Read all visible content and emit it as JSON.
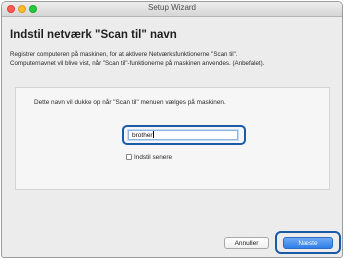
{
  "window": {
    "title": "Setup Wizard"
  },
  "page": {
    "heading": "Indstil netværk \"Scan til\" navn",
    "description_line1": "Registrer computeren på maskinen, for at aktivere Netværksfunktionerne \"Scan til\".",
    "description_line2": "Computernavnet vil blive vist, når \"Scan til\"-funktionerne på maskinen anvendes. (Anbefalet)."
  },
  "panel": {
    "info_text": "Dette navn vil dukke op når \"Scan til\" menuen vælges på maskinen.",
    "name_input_value": "brother",
    "checkbox_label": "Indstil senere",
    "checkbox_checked": false
  },
  "buttons": {
    "cancel_label": "Annuller",
    "next_label": "Næste"
  },
  "colors": {
    "highlight_ring": "#1a5aa8",
    "primary_button": "#2f7fe8",
    "traffic_close": "#fc5d57",
    "traffic_minimize": "#fdbb30",
    "traffic_zoom": "#28c840"
  }
}
